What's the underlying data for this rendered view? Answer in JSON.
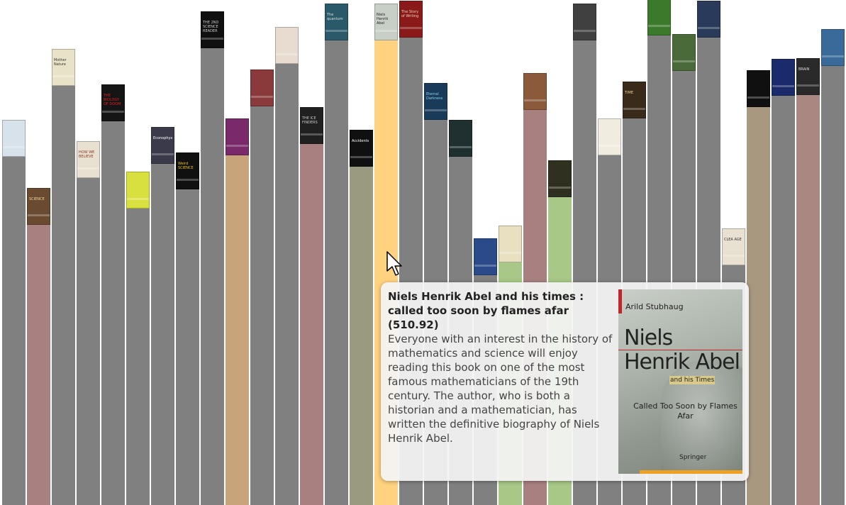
{
  "books": [
    {
      "title": "",
      "color": "#808080",
      "height": 0.69,
      "cover": "#d8e2ea",
      "cover_text": "",
      "covertext_color": "#3a5a8a"
    },
    {
      "title": "",
      "color": "#a88080",
      "height": 0.555,
      "cover": "#6a4a30",
      "cover_text": "SCIENCE",
      "covertext_color": "#f0d8a0"
    },
    {
      "title": "",
      "color": "#808080",
      "height": 0.83,
      "cover": "#e8e3c8",
      "cover_text": "Mother Nature",
      "covertext_color": "#333"
    },
    {
      "title": "",
      "color": "#808080",
      "height": 0.647,
      "cover": "#e8e0d0",
      "cover_text": "HOW WE BELIEVE",
      "covertext_color": "#8a3a20"
    },
    {
      "title": "",
      "color": "#808080",
      "height": 0.76,
      "cover": "#151515",
      "cover_text": "THE BIOLOGY OF DOOM",
      "covertext_color": "#e02020"
    },
    {
      "title": "",
      "color": "#808080",
      "height": 0.587,
      "cover": "#d8e040",
      "cover_text": "",
      "covertext_color": "#333"
    },
    {
      "title": "",
      "color": "#808080",
      "height": 0.675,
      "cover": "#3a3a4a",
      "cover_text": "Econophysics",
      "covertext_color": "#fff"
    },
    {
      "title": "",
      "color": "#808080",
      "height": 0.625,
      "cover": "#101010",
      "cover_text": "Weird SCIENCE",
      "covertext_color": "#e8c020"
    },
    {
      "title": "",
      "color": "#808080",
      "height": 0.905,
      "cover": "#101010",
      "cover_text": "THE 2ND SCIENCE READER",
      "covertext_color": "#ccc"
    },
    {
      "title": "",
      "color": "#c8a47a",
      "height": 0.692,
      "cover": "#7a2a6a",
      "cover_text": "",
      "covertext_color": "#fff"
    },
    {
      "title": "",
      "color": "#808080",
      "height": 0.79,
      "cover": "#8a3a3a",
      "cover_text": "",
      "covertext_color": "#fff"
    },
    {
      "title": "",
      "color": "#808080",
      "height": 0.874,
      "cover": "#e8dcd0",
      "cover_text": "",
      "covertext_color": "#333"
    },
    {
      "title": "",
      "color": "#a88080",
      "height": 0.715,
      "cover": "#202020",
      "cover_text": "THE ICE FINDERS",
      "covertext_color": "#ccc"
    },
    {
      "title": "",
      "color": "#808080",
      "height": 0.92,
      "cover": "#2a5a6a",
      "cover_text": "The quantum",
      "covertext_color": "#ddd"
    },
    {
      "title": "",
      "color": "#9a9a80",
      "height": 0.67,
      "cover": "#101010",
      "cover_text": "Accidents",
      "covertext_color": "#fff"
    },
    {
      "title": "Niels Henrik Abel and his times : called too soon by flames afar (510.92)",
      "color": "#ffd27f",
      "height": 0.92,
      "cover": "#c8cfc6",
      "cover_text": "Niels Henrik Abel",
      "covertext_color": "#222"
    },
    {
      "title": "",
      "color": "#808080",
      "height": 0.925,
      "cover": "#8a1a1a",
      "cover_text": "The Story of Writing",
      "covertext_color": "#f0d0b0"
    },
    {
      "title": "",
      "color": "#808080",
      "height": 0.762,
      "cover": "#1a3a5a",
      "cover_text": "Eternal Darkness",
      "covertext_color": "#8ad0f0"
    },
    {
      "title": "",
      "color": "#808080",
      "height": 0.69,
      "cover": "#203030",
      "cover_text": "",
      "covertext_color": "#fff"
    },
    {
      "title": "",
      "color": "#808080",
      "height": 0.455,
      "cover": "#2a4a8a",
      "cover_text": "",
      "covertext_color": "#fff"
    },
    {
      "title": "",
      "color": "#a8c888",
      "height": 0.48,
      "cover": "#e8e0c0",
      "cover_text": "",
      "covertext_color": "#333"
    },
    {
      "title": "",
      "color": "#a88080",
      "height": 0.783,
      "cover": "#8a5a3a",
      "cover_text": "",
      "covertext_color": "#fff"
    },
    {
      "title": "",
      "color": "#a8c888",
      "height": 0.61,
      "cover": "#303020",
      "cover_text": "",
      "covertext_color": "#fff"
    },
    {
      "title": "",
      "color": "#808080",
      "height": 0.92,
      "cover": "#404040",
      "cover_text": "",
      "covertext_color": "#fff"
    },
    {
      "title": "",
      "color": "#808080",
      "height": 0.693,
      "cover": "#f0ece0",
      "cover_text": "",
      "covertext_color": "#333"
    },
    {
      "title": "",
      "color": "#808080",
      "height": 0.765,
      "cover": "#3a2a1a",
      "cover_text": "TIME",
      "covertext_color": "#f0d0a0"
    },
    {
      "title": "",
      "color": "#808080",
      "height": 0.93,
      "cover": "#3a7a2a",
      "cover_text": "",
      "covertext_color": "#fff"
    },
    {
      "title": "",
      "color": "#808080",
      "height": 0.86,
      "cover": "#4a6a3a",
      "cover_text": "",
      "covertext_color": "#fff"
    },
    {
      "title": "",
      "color": "#808080",
      "height": 0.925,
      "cover": "#2a3a5a",
      "cover_text": "",
      "covertext_color": "#fff"
    },
    {
      "title": "",
      "color": "#808080",
      "height": 0.475,
      "cover": "#e8e0d0",
      "cover_text": "CLEA AGE",
      "covertext_color": "#333"
    },
    {
      "title": "",
      "color": "#a89880",
      "height": 0.788,
      "cover": "#101010",
      "cover_text": "",
      "covertext_color": "#c040c0"
    },
    {
      "title": "",
      "color": "#808080",
      "height": 0.81,
      "cover": "#1a2a6a",
      "cover_text": "",
      "covertext_color": "#fff"
    },
    {
      "title": "",
      "color": "#a88880",
      "height": 0.812,
      "cover": "#2a2a2a",
      "cover_text": "BRAIN",
      "covertext_color": "#ddd"
    },
    {
      "title": "",
      "color": "#808080",
      "height": 0.87,
      "cover": "#3a6a9a",
      "cover_text": "",
      "covertext_color": "#fff"
    }
  ],
  "tooltip": {
    "title_line": "Niels Henrik Abel and his times : called too soon by flames afar (510.92)",
    "description": "Everyone with an interest in the history of mathematics and science will enjoy reading this book on one of the most famous mathematicians of the 19th century. The author, who is both a historian and a mathematician, has written the definitive biography of Niels Henrik Abel.",
    "cover_author": "Arild Stubhaug",
    "cover_title": "Niels Henrik Abel",
    "cover_and": "and his Times",
    "cover_subtitle": "Called Too Soon by Flames Afar",
    "cover_publisher": "Springer"
  }
}
